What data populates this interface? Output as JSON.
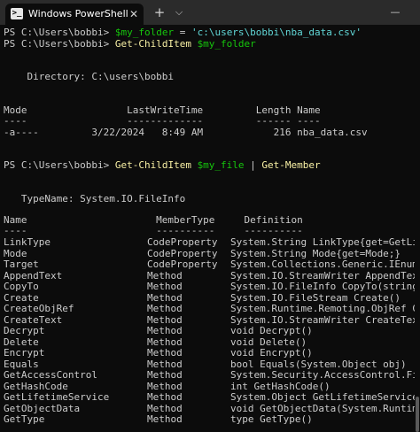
{
  "window": {
    "tab_title": "Windows PowerShell",
    "tab_close": "✕",
    "new_tab": "+",
    "dropdown": "⌵",
    "minimize": "—"
  },
  "terminal": {
    "prompt1": "PS C:\\Users\\bobbi>",
    "cmd1_var": "$my_folder",
    "cmd1_eq": " = ",
    "cmd1_str": "'c:\\users\\bobbi\\nba_data.csv'",
    "prompt2": "PS C:\\Users\\bobbi>",
    "cmd2_name": "Get-ChildItem",
    "cmd2_arg": "$my_folder",
    "directory": "    Directory: C:\\users\\bobbi",
    "dir_header": "Mode                 LastWriteTime         Length Name",
    "dir_sep": "----                 -------------         ------ ----",
    "dir_row": "-a----         3/22/2024   8:49 AM            216 nba_data.csv",
    "prompt3": "PS C:\\Users\\bobbi>",
    "cmd3_name": "Get-ChildItem",
    "cmd3_arg": "$my_file",
    "cmd3_pipe": " | ",
    "cmd3_name2": "Get-Member",
    "typename": "   TypeName: System.IO.FileInfo",
    "members_header": "Name                      MemberType     Definition",
    "members_sep": "----                      ----------     ----------",
    "members": [
      {
        "name": "LinkType",
        "type": "CodeProperty",
        "def": "System.String LinkType{get=GetLink"
      },
      {
        "name": "Mode",
        "type": "CodeProperty",
        "def": "System.String Mode{get=Mode;}"
      },
      {
        "name": "Target",
        "type": "CodeProperty",
        "def": "System.Collections.Generic.IEnumer"
      },
      {
        "name": "AppendText",
        "type": "Method",
        "def": "System.IO.StreamWriter AppendText("
      },
      {
        "name": "CopyTo",
        "type": "Method",
        "def": "System.IO.FileInfo CopyTo(string d"
      },
      {
        "name": "Create",
        "type": "Method",
        "def": "System.IO.FileStream Create()"
      },
      {
        "name": "CreateObjRef",
        "type": "Method",
        "def": "System.Runtime.Remoting.ObjRef Cre"
      },
      {
        "name": "CreateText",
        "type": "Method",
        "def": "System.IO.StreamWriter CreateText("
      },
      {
        "name": "Decrypt",
        "type": "Method",
        "def": "void Decrypt()"
      },
      {
        "name": "Delete",
        "type": "Method",
        "def": "void Delete()"
      },
      {
        "name": "Encrypt",
        "type": "Method",
        "def": "void Encrypt()"
      },
      {
        "name": "Equals",
        "type": "Method",
        "def": "bool Equals(System.Object obj)"
      },
      {
        "name": "GetAccessControl",
        "type": "Method",
        "def": "System.Security.AccessControl.File"
      },
      {
        "name": "GetHashCode",
        "type": "Method",
        "def": "int GetHashCode()"
      },
      {
        "name": "GetLifetimeService",
        "type": "Method",
        "def": "System.Object GetLifetimeService()"
      },
      {
        "name": "GetObjectData",
        "type": "Method",
        "def": "void GetObjectData(System.Runtime."
      },
      {
        "name": "GetType",
        "type": "Method",
        "def": "type GetType()"
      }
    ]
  }
}
